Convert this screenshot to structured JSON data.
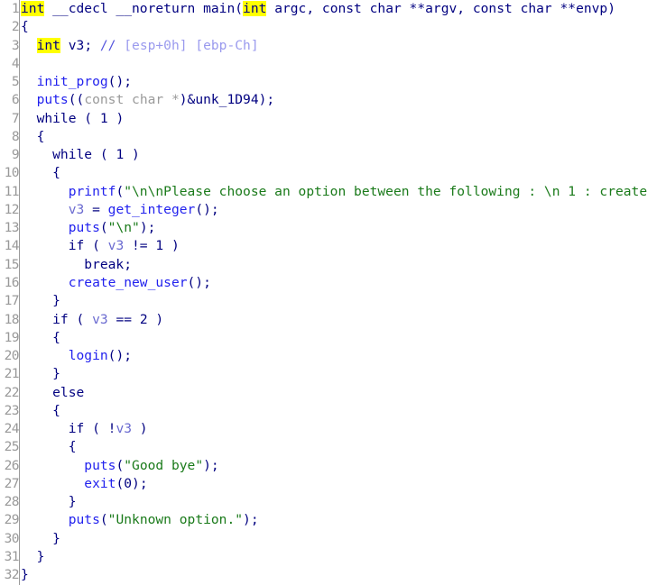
{
  "view": {
    "title": "Pseudocode",
    "language": "c",
    "total_lines": 32,
    "colors": {
      "background": "#ffffff",
      "gutter_text": "#999999",
      "gutter_separator": "#9a9a9a",
      "keyword": "#000080",
      "keyword_highlight_bg": "#ffff00",
      "function_name": "#2222ee",
      "string_literal": "#1a7a1a",
      "cast_type": "#9a9a9a",
      "local_variable": "#6a6ad0",
      "comment": "#5555dd",
      "comment_location": "#9a9aee"
    }
  },
  "lines": [
    {
      "number": "1",
      "plain": "int __cdecl __noreturn main(int argc, const char **argv, const char **envp)",
      "tokens": [
        {
          "text": "int",
          "cls": "t-kw-hl"
        },
        {
          "text": " __cdecl __noreturn ",
          "cls": "t-kw"
        },
        {
          "text": "main",
          "cls": "t-kw"
        },
        {
          "text": "(",
          "cls": "t-kw"
        },
        {
          "text": "int",
          "cls": "t-kw-hl"
        },
        {
          "text": " argc, const char **argv, const char **envp)",
          "cls": "t-kw"
        }
      ]
    },
    {
      "number": "2",
      "plain": "{",
      "tokens": [
        {
          "text": "{",
          "cls": "t-kw"
        }
      ]
    },
    {
      "number": "3",
      "plain": "  int v3; // [esp+0h] [ebp-Ch]",
      "tokens": [
        {
          "text": "  ",
          "cls": "t-kw"
        },
        {
          "text": "int",
          "cls": "t-kw-hl"
        },
        {
          "text": " ",
          "cls": "t-kw"
        },
        {
          "text": "v3",
          "cls": "t-kw"
        },
        {
          "text": "; ",
          "cls": "t-kw"
        },
        {
          "text": "// ",
          "cls": "t-cmt"
        },
        {
          "text": "[esp+0h] [ebp-Ch]",
          "cls": "t-cmtloc"
        }
      ]
    },
    {
      "number": "4",
      "plain": "",
      "tokens": []
    },
    {
      "number": "5",
      "plain": "  init_prog();",
      "tokens": [
        {
          "text": "  ",
          "cls": "t-kw"
        },
        {
          "text": "init_prog",
          "cls": "t-fn"
        },
        {
          "text": "();",
          "cls": "t-kw"
        }
      ]
    },
    {
      "number": "6",
      "plain": "  puts((const char *)&unk_1D94);",
      "tokens": [
        {
          "text": "  ",
          "cls": "t-kw"
        },
        {
          "text": "puts",
          "cls": "t-fn"
        },
        {
          "text": "((",
          "cls": "t-kw"
        },
        {
          "text": "const char *",
          "cls": "t-cast"
        },
        {
          "text": ")&unk_1D94);",
          "cls": "t-kw"
        }
      ]
    },
    {
      "number": "7",
      "plain": "  while ( 1 )",
      "tokens": [
        {
          "text": "  while ( ",
          "cls": "t-kw"
        },
        {
          "text": "1",
          "cls": "t-num"
        },
        {
          "text": " )",
          "cls": "t-kw"
        }
      ]
    },
    {
      "number": "8",
      "plain": "  {",
      "tokens": [
        {
          "text": "  {",
          "cls": "t-kw"
        }
      ]
    },
    {
      "number": "9",
      "plain": "    while ( 1 )",
      "tokens": [
        {
          "text": "    while ( ",
          "cls": "t-kw"
        },
        {
          "text": "1",
          "cls": "t-num"
        },
        {
          "text": " )",
          "cls": "t-kw"
        }
      ]
    },
    {
      "number": "10",
      "plain": "    {",
      "tokens": [
        {
          "text": "    {",
          "cls": "t-kw"
        }
      ]
    },
    {
      "number": "11",
      "plain": "      printf(\"\\n\\nPlease choose an option between the following : \\n 1 : create",
      "tokens": [
        {
          "text": "      ",
          "cls": "t-kw"
        },
        {
          "text": "printf",
          "cls": "t-fn"
        },
        {
          "text": "(",
          "cls": "t-kw"
        },
        {
          "text": "\"\\n\\nPlease choose an option between the following : \\n 1 : create",
          "cls": "t-str"
        }
      ]
    },
    {
      "number": "12",
      "plain": "      v3 = get_integer();",
      "tokens": [
        {
          "text": "      ",
          "cls": "t-kw"
        },
        {
          "text": "v3",
          "cls": "t-var"
        },
        {
          "text": " = ",
          "cls": "t-kw"
        },
        {
          "text": "get_integer",
          "cls": "t-fn"
        },
        {
          "text": "();",
          "cls": "t-kw"
        }
      ]
    },
    {
      "number": "13",
      "plain": "      puts(\"\\n\");",
      "tokens": [
        {
          "text": "      ",
          "cls": "t-kw"
        },
        {
          "text": "puts",
          "cls": "t-fn"
        },
        {
          "text": "(",
          "cls": "t-kw"
        },
        {
          "text": "\"\\n\"",
          "cls": "t-str"
        },
        {
          "text": ");",
          "cls": "t-kw"
        }
      ]
    },
    {
      "number": "14",
      "plain": "      if ( v3 != 1 )",
      "tokens": [
        {
          "text": "      if ( ",
          "cls": "t-kw"
        },
        {
          "text": "v3",
          "cls": "t-var"
        },
        {
          "text": " != ",
          "cls": "t-kw"
        },
        {
          "text": "1",
          "cls": "t-num"
        },
        {
          "text": " )",
          "cls": "t-kw"
        }
      ]
    },
    {
      "number": "15",
      "plain": "        break;",
      "tokens": [
        {
          "text": "        break;",
          "cls": "t-kw"
        }
      ]
    },
    {
      "number": "16",
      "plain": "      create_new_user();",
      "tokens": [
        {
          "text": "      ",
          "cls": "t-kw"
        },
        {
          "text": "create_new_user",
          "cls": "t-fn"
        },
        {
          "text": "();",
          "cls": "t-kw"
        }
      ]
    },
    {
      "number": "17",
      "plain": "    }",
      "tokens": [
        {
          "text": "    }",
          "cls": "t-kw"
        }
      ]
    },
    {
      "number": "18",
      "plain": "    if ( v3 == 2 )",
      "tokens": [
        {
          "text": "    if ( ",
          "cls": "t-kw"
        },
        {
          "text": "v3",
          "cls": "t-var"
        },
        {
          "text": " == ",
          "cls": "t-kw"
        },
        {
          "text": "2",
          "cls": "t-num"
        },
        {
          "text": " )",
          "cls": "t-kw"
        }
      ]
    },
    {
      "number": "19",
      "plain": "    {",
      "tokens": [
        {
          "text": "    {",
          "cls": "t-kw"
        }
      ]
    },
    {
      "number": "20",
      "plain": "      login();",
      "tokens": [
        {
          "text": "      ",
          "cls": "t-kw"
        },
        {
          "text": "login",
          "cls": "t-fn"
        },
        {
          "text": "();",
          "cls": "t-kw"
        }
      ]
    },
    {
      "number": "21",
      "plain": "    }",
      "tokens": [
        {
          "text": "    }",
          "cls": "t-kw"
        }
      ]
    },
    {
      "number": "22",
      "plain": "    else",
      "tokens": [
        {
          "text": "    else",
          "cls": "t-kw"
        }
      ]
    },
    {
      "number": "23",
      "plain": "    {",
      "tokens": [
        {
          "text": "    {",
          "cls": "t-kw"
        }
      ]
    },
    {
      "number": "24",
      "plain": "      if ( !v3 )",
      "tokens": [
        {
          "text": "      if ( !",
          "cls": "t-kw"
        },
        {
          "text": "v3",
          "cls": "t-var"
        },
        {
          "text": " )",
          "cls": "t-kw"
        }
      ]
    },
    {
      "number": "25",
      "plain": "      {",
      "tokens": [
        {
          "text": "      {",
          "cls": "t-kw"
        }
      ]
    },
    {
      "number": "26",
      "plain": "        puts(\"Good bye\");",
      "tokens": [
        {
          "text": "        ",
          "cls": "t-kw"
        },
        {
          "text": "puts",
          "cls": "t-fn"
        },
        {
          "text": "(",
          "cls": "t-kw"
        },
        {
          "text": "\"Good bye\"",
          "cls": "t-str"
        },
        {
          "text": ");",
          "cls": "t-kw"
        }
      ]
    },
    {
      "number": "27",
      "plain": "        exit(0);",
      "tokens": [
        {
          "text": "        ",
          "cls": "t-kw"
        },
        {
          "text": "exit",
          "cls": "t-fn"
        },
        {
          "text": "(",
          "cls": "t-kw"
        },
        {
          "text": "0",
          "cls": "t-num"
        },
        {
          "text": ");",
          "cls": "t-kw"
        }
      ]
    },
    {
      "number": "28",
      "plain": "      }",
      "tokens": [
        {
          "text": "      }",
          "cls": "t-kw"
        }
      ]
    },
    {
      "number": "29",
      "plain": "      puts(\"Unknown option.\");",
      "tokens": [
        {
          "text": "      ",
          "cls": "t-kw"
        },
        {
          "text": "puts",
          "cls": "t-fn"
        },
        {
          "text": "(",
          "cls": "t-kw"
        },
        {
          "text": "\"Unknown option.\"",
          "cls": "t-str"
        },
        {
          "text": ");",
          "cls": "t-kw"
        }
      ]
    },
    {
      "number": "30",
      "plain": "    }",
      "tokens": [
        {
          "text": "    }",
          "cls": "t-kw"
        }
      ]
    },
    {
      "number": "31",
      "plain": "  }",
      "tokens": [
        {
          "text": "  }",
          "cls": "t-kw"
        }
      ]
    },
    {
      "number": "32",
      "plain": "}",
      "tokens": [
        {
          "text": "}",
          "cls": "t-kw"
        }
      ]
    }
  ]
}
